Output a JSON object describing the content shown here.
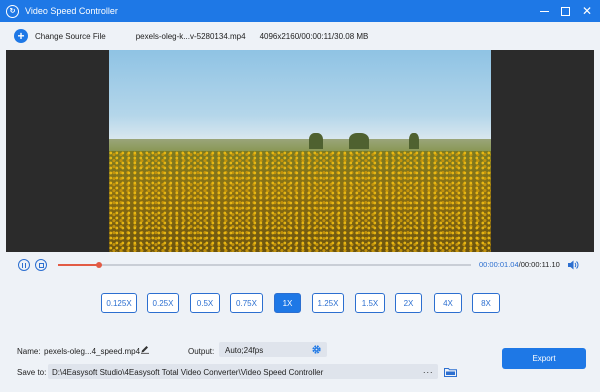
{
  "window": {
    "title": "Video Speed Controller",
    "icons": [
      "app-icon",
      "minimize-icon",
      "maximize-icon",
      "close-icon"
    ]
  },
  "toolbar": {
    "change_source_label": "Change Source File",
    "file_name": "pexels-oleg-k...v-5280134.mp4",
    "file_info": "4096x2160/00:00:11/30.08 MB"
  },
  "player": {
    "current_time": "00:00:01.04",
    "separator": "/",
    "total_time": "00:00:11.10",
    "progress": 0.1,
    "colors": {
      "accent": "#1e78e6",
      "progress": "#e25b45"
    }
  },
  "speeds": {
    "options": [
      "0.125X",
      "0.25X",
      "0.5X",
      "0.75X",
      "1X",
      "1.25X",
      "1.5X",
      "2X",
      "4X",
      "8X"
    ],
    "selected": "1X"
  },
  "output": {
    "name_label": "Name:",
    "name_value": "pexels-oleg...4_speed.mp4",
    "output_label": "Output:",
    "output_value": "Auto;24fps",
    "save_label": "Save to:",
    "save_path": "D:\\4Easysoft Studio\\4Easysoft Total Video Converter\\Video Speed Controller",
    "browse_label": "···",
    "export_label": "Export"
  }
}
